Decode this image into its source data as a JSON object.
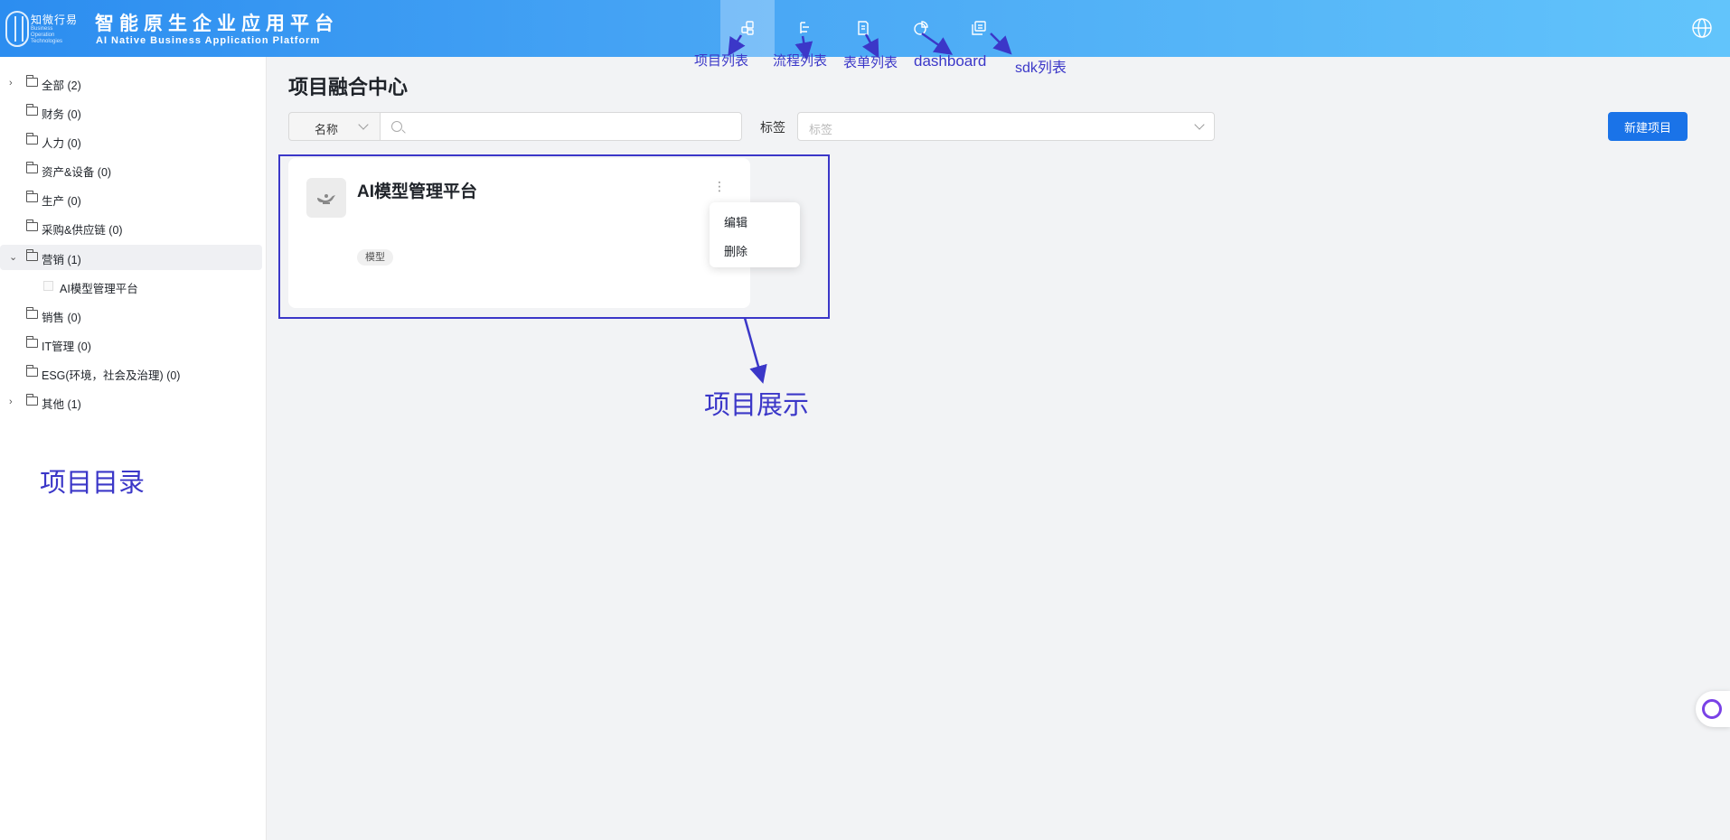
{
  "header": {
    "logo_cn": "知微行易",
    "logo_en": "Business Operation Technologies",
    "title": "智能原生企业应用平台",
    "subtitle": "AI Native Business Application Platform",
    "nav": [
      {
        "icon": "project-list-icon",
        "active": true
      },
      {
        "icon": "flow-list-icon",
        "active": false
      },
      {
        "icon": "form-list-icon",
        "active": false
      },
      {
        "icon": "dashboard-icon",
        "active": false
      },
      {
        "icon": "sdk-list-icon",
        "active": false
      }
    ]
  },
  "sidebar": {
    "items": [
      {
        "label": "全部 (2)",
        "arrow": "right"
      },
      {
        "label": "财务 (0)"
      },
      {
        "label": "人力 (0)"
      },
      {
        "label": "资产&设备 (0)"
      },
      {
        "label": "生产 (0)"
      },
      {
        "label": "采购&供应链 (0)"
      },
      {
        "label": "营销 (1)",
        "arrow": "down",
        "selected": true
      },
      {
        "label": "AI模型管理平台",
        "child": true
      },
      {
        "label": "销售 (0)"
      },
      {
        "label": "IT管理 (0)"
      },
      {
        "label": "ESG(环境，社会及治理) (0)"
      },
      {
        "label": "其他 (1)",
        "arrow": "right"
      }
    ]
  },
  "main": {
    "title": "项目融合中心",
    "filter_select": "名称",
    "tag_label": "标签",
    "tag_placeholder": "标签",
    "new_button": "新建项目",
    "card": {
      "title": "AI模型管理平台",
      "tag": "模型",
      "menu": [
        "编辑",
        "删除"
      ]
    }
  },
  "annotations": {
    "nav_labels": [
      "项目列表",
      "流程列表",
      "表单列表",
      "dashboard",
      "sdk列表"
    ],
    "project_display": "项目展示",
    "project_catalog": "项目目录",
    "color": "#3b37c8"
  }
}
